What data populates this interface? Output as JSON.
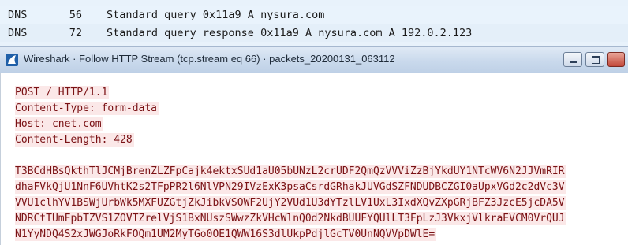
{
  "packets": [
    {
      "protocol": "DNS",
      "length": "56",
      "info": "Standard query 0x11a9 A nysura.com"
    },
    {
      "protocol": "DNS",
      "length": "72",
      "info": "Standard query response 0x11a9 A nysura.com A 192.0.2.123"
    }
  ],
  "window": {
    "title": "Wireshark · Follow HTTP Stream (tcp.stream eq 66) · packets_20200131_063112"
  },
  "stream": {
    "request_lines": [
      "POST / HTTP/1.1",
      "Content-Type: form-data",
      "Host: cnet.com",
      "Content-Length: 428"
    ],
    "body_lines": [
      "T3BCdHBsQkthTlJCMjBrenZLZFpCajk4ektxSUd1aU05bUNzL2crUDF2QmQzVVViZzBjYkdUY1NTcWV6N2JJVmRIR",
      "dhaFVkQjU1NnF6UVhtK2s2TFpPR2l6NlVPN29IVzExK3psaCsrdGRhakJUVGdSZFNDUDBCZGI0aUpxVGd2c2dVc3V",
      "VVU1clhYV1BSWjUrbWk5MXFUZGtjZkJibkVSOWF2UjY2VUd1U3dYTzlLV1UxL3IxdXQvZXpGRjBFZ3JzcE5jcDA5V",
      "NDRCtTUmFpbTZVS1ZOVTZrelVjS1BxNUszSWwzZkVHcWlnQ0d2NkdBUUFYQUlLT3FpLzJ3VkxjVlkraEVCM0VrQUJ",
      "N1YyNDQ4S2xJWGJoRkFOQm1UM2MyTGo0OE1QWW16S3dlUkpPdjlGcTV0UnNQVVpDWlE="
    ]
  },
  "colors": {
    "stream_text": "#7a1215",
    "stream_bg": "#fbe8e8",
    "packet_row_bg": "#e8f2fb"
  },
  "icons": {
    "app": "wireshark-fin-icon",
    "minimize": "minimize-icon",
    "maximize": "maximize-icon",
    "close": "close-icon"
  }
}
